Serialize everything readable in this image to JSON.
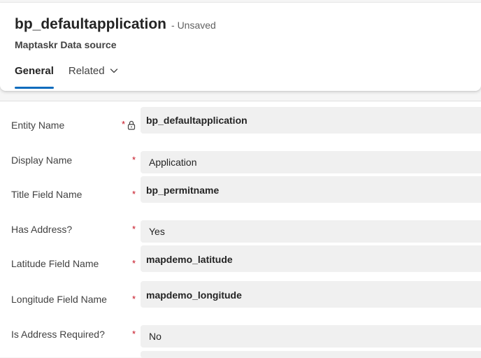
{
  "header": {
    "title": "bp_defaultapplication",
    "save_status": "- Unsaved",
    "subtitle": "Maptaskr Data source",
    "tabs": [
      {
        "label": "General"
      },
      {
        "label": "Related"
      }
    ]
  },
  "form": {
    "required_marker": "*",
    "fields": [
      {
        "label": "Entity Name",
        "value": "bp_defaultapplication",
        "locked": true
      },
      {
        "label": "Display Name",
        "value": "Application"
      },
      {
        "label": "Title Field Name",
        "value": "bp_permitname"
      },
      {
        "label": "Has Address?",
        "value": "Yes"
      },
      {
        "label": "Latitude Field Name",
        "value": "mapdemo_latitude"
      },
      {
        "label": "Longitude Field Name",
        "value": "mapdemo_longitude"
      },
      {
        "label": "Is Address Required?",
        "value": "No"
      }
    ]
  },
  "colors": {
    "accent": "#0f6cbd",
    "required": "#c50f1f",
    "field_bg": "#f0f0f0"
  }
}
